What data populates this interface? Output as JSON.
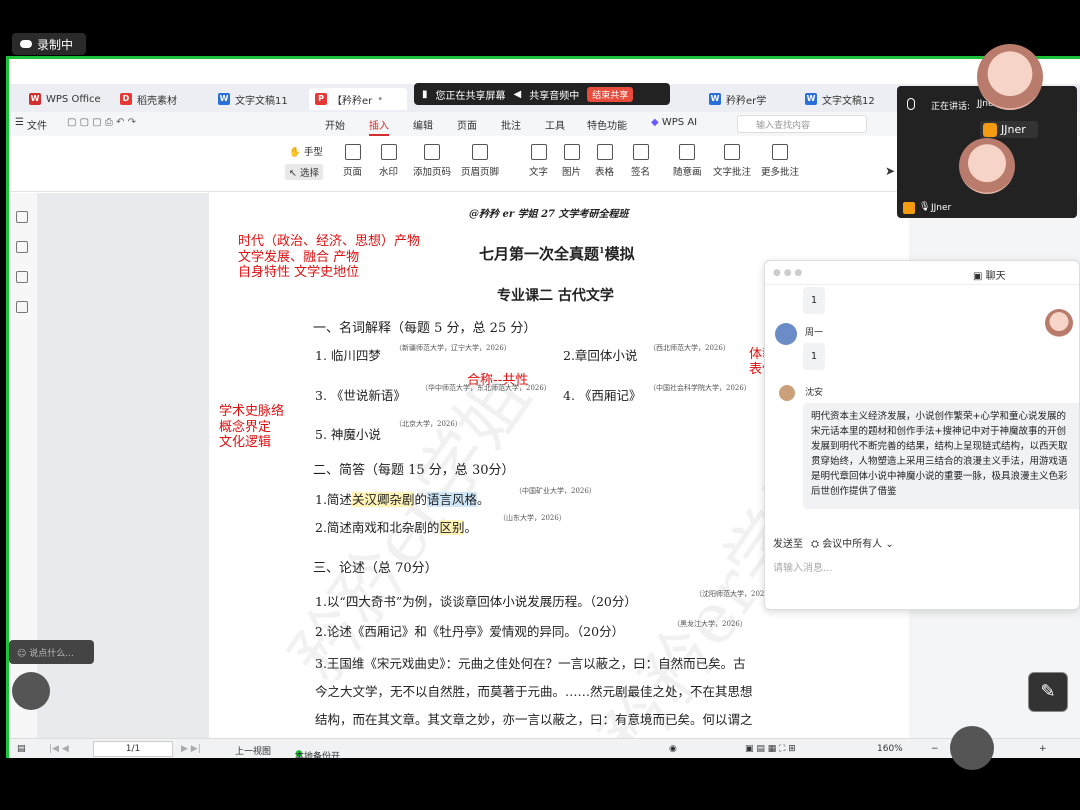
{
  "recording": {
    "label": "录制中"
  },
  "tabs": [
    {
      "label": "WPS Office",
      "icon": "wps-logo-icon",
      "color": "#d32f2f"
    },
    {
      "label": "稻壳素材",
      "icon": "docer-icon",
      "color": "#e53935"
    },
    {
      "label": "文字文稿11",
      "icon": "word-doc-icon",
      "color": "#2b6fd8"
    },
    {
      "label": "【矜矜er",
      "icon": "pdf-icon",
      "color": "#e53935"
    },
    {
      "label": "矜矜er学",
      "icon": "word-doc-icon",
      "color": "#2b6fd8"
    },
    {
      "label": "文字文稿12",
      "icon": "word-doc-icon",
      "color": "#2b6fd8"
    }
  ],
  "share_bar": {
    "sharing": "您正在共享屏幕",
    "audio": "共享音频中",
    "end": "结束共享"
  },
  "menu": {
    "file": "文件",
    "items": [
      "开始",
      "插入",
      "编辑",
      "页面",
      "批注",
      "工具",
      "特色功能",
      "WPS AI"
    ],
    "active": "插入",
    "search_placeholder": "输入查找内容"
  },
  "ribbon": {
    "hand": "手型",
    "select": "选择",
    "buttons": [
      "页面",
      "水印",
      "添加页码",
      "页眉页脚",
      "文字",
      "图片",
      "表格",
      "签名",
      "随意画",
      "文字批注",
      "更多批注"
    ]
  },
  "doc": {
    "header": "@矜矜 er 学姐 27 文学考研全程班",
    "title": "七月第一次全真题",
    "title_sup": "1",
    "title_suffix": "模拟",
    "subtitle": "专业课二  古代文学",
    "sec1": "一、名词解释（每题 5 分，总 25 分）",
    "t1": "1. 临川四梦",
    "s1": "（新疆师范大学，辽宁大学，2026）",
    "t2": "2.章回体小说",
    "s2": "（西北师范大学，2026）",
    "t3": "3. 《世说新语》",
    "s3": "（华中师范大学，东北师范大学，2026）",
    "t4": "4. 《西厢记》",
    "s4": "（中国社会科学院大学，2026）",
    "t5": "5. 神魔小说",
    "s5": "（北京大学，2026）",
    "sec2": "二、简答（每题 15 分，总 30分）",
    "q1a": "1.简述",
    "q1b": "关汉卿杂剧",
    "q1c": "的",
    "q1d": "语言风格",
    "q1e": "。",
    "q1s": "（中国矿业大学，2026）",
    "q2a": "2.简述南戏和北杂剧的",
    "q2b": "区别",
    "q2c": "。",
    "q2s": "（山东大学，2026）",
    "sec3": "三、论述（总 70分）",
    "l1": "1.以“四大奇书”为例，谈谈章回体小说发展历程。（20分）",
    "l1s": "（沈阳师范大学，202",
    "l2": "2.论述《西厢记》和《牡丹亭》爱情观的异同。（20分）",
    "l2s": "（黑龙江大学，2026）",
    "l3": "3.王国维《宋元戏曲史》：元曲之佳处何在？一言以蔽之，曰：自然而已矣。古",
    "l4": "今之大文学，无不以自然胜，而莫著于元曲。……然元剧最佳之处，不在其思想",
    "l5": "结构，而在其文章。其文章之妙，亦一言以蔽之，曰：有意境而已矣。何以谓之"
  },
  "annotations": {
    "a1": "时代（政治、经济、思想）产物",
    "a2": "文学发展、融合 产物",
    "a3": "自身特性  文学史地位",
    "a4": "合称--共性",
    "a5": "学术史脉络",
    "a6": "概念界定",
    "a7": "文化逻辑",
    "a8": "体裁",
    "a9": "表何"
  },
  "watermark": {
    "w1": "矜矜er学姐",
    "w2": "矜矜er学姐"
  },
  "status": {
    "pages": "1/1",
    "prev_view": "上一视图",
    "backup": "本地备份开",
    "zoom": "160%"
  },
  "video": {
    "speaking_label": "正在讲话:",
    "speaker": "JJner",
    "name_badge": "JJner",
    "self_name": "JJner"
  },
  "chat": {
    "title": "聊天",
    "m1": "1",
    "user2": "周一",
    "m2": "1",
    "user3": "沈安",
    "long_msg": [
      "明代资本主义经济发展，小说创作繁荣+心学和童心说发展的",
      "宋元话本里的题材和创作手法+搜神记中对于神魔故事的开创",
      "发展到明代不断完善的结果，结构上呈现链式结构，以西天取",
      "贯穿始终，人物塑造上采用三结合的浪漫主义手法，用游戏语",
      "是明代章回体小说中神魔小说的重要一脉，极具浪漫主义色彩",
      "后世创作提供了借鉴"
    ],
    "send_to": "发送至",
    "recipient": "会议中所有人",
    "input_placeholder": "请输入消息..."
  },
  "assistant": {
    "placeholder": "说点什么..."
  }
}
